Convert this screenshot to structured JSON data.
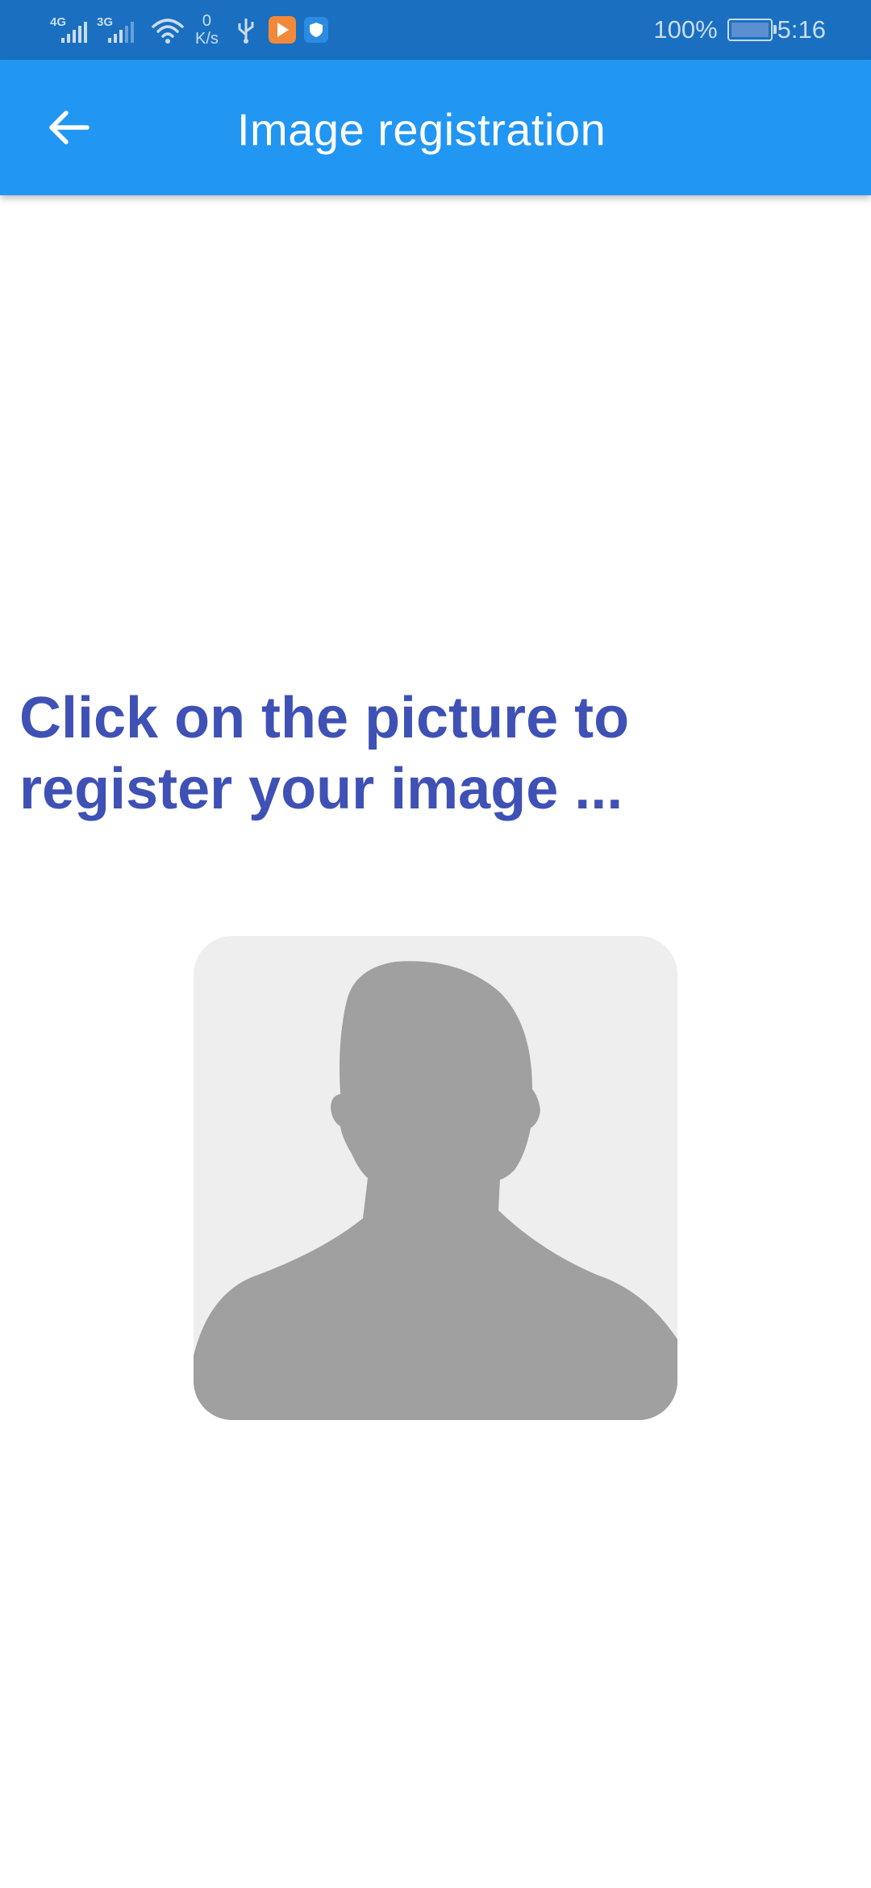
{
  "status_bar": {
    "network1": "4G",
    "network2": "3G",
    "speed_value": "0",
    "speed_unit": "K/s",
    "battery": "100%",
    "time": "5:16"
  },
  "app_bar": {
    "title": "Image registration",
    "back_icon": "arrow-back-icon",
    "color": "#2196f3"
  },
  "content": {
    "instruction": "Click on the picture to register your image ...",
    "instruction_color": "#3f51b5",
    "avatar_icon": "person-silhouette-icon"
  }
}
